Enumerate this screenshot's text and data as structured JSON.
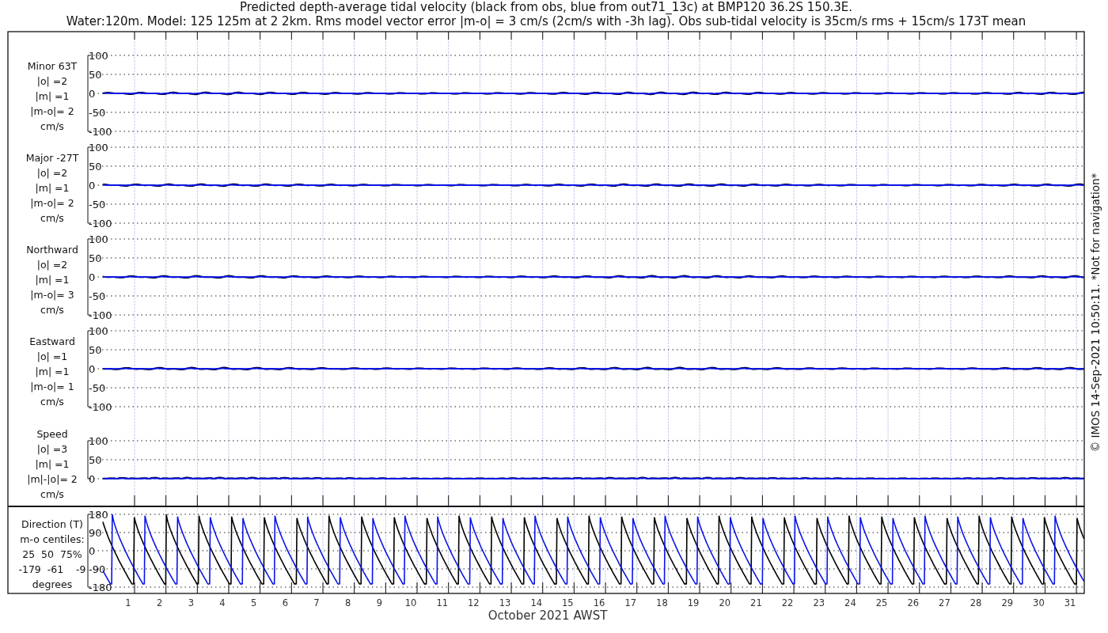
{
  "title_lines": [
    "Predicted depth-average tidal velocity (black from obs, blue from out71_13c) at BMP120 36.2S 150.3E.",
    "Water:120m. Model: 125 125m at 2 2km. Rms model vector error |m-o| = 3 cm/s (2cm/s with -3h lag). Obs sub-tidal velocity is 35cm/s rms + 15cm/s 173T mean"
  ],
  "panels": [
    {
      "kind": "velocity",
      "label_lines": [
        "Minor 63T",
        "|o| =2",
        "|m| =1",
        "|m-o|= 2",
        "cm/s"
      ],
      "y_tick_labels": [
        "100",
        "50",
        "0",
        "-50",
        "-100"
      ]
    },
    {
      "kind": "velocity",
      "label_lines": [
        "Major -27T",
        "|o| =2",
        "|m| =1",
        "|m-o|= 2",
        "cm/s"
      ],
      "y_tick_labels": [
        "100",
        "50",
        "0",
        "-50",
        "-100"
      ]
    },
    {
      "kind": "velocity",
      "label_lines": [
        "Northward",
        "|o| =2",
        "|m| =1",
        "|m-o|= 3",
        "cm/s"
      ],
      "y_tick_labels": [
        "100",
        "50",
        "0",
        "-50",
        "-100"
      ]
    },
    {
      "kind": "velocity",
      "label_lines": [
        "Eastward",
        "|o| =1",
        "|m| =1",
        "|m-o|= 1",
        "cm/s"
      ],
      "y_tick_labels": [
        "100",
        "50",
        "0",
        "-50",
        "-100"
      ]
    },
    {
      "kind": "speed",
      "label_lines": [
        "Speed",
        "|o| =3",
        "|m| =1",
        "|m|-|o|= 2",
        "cm/s"
      ],
      "y_tick_labels": [
        "100",
        "50",
        "0"
      ]
    },
    {
      "kind": "direction",
      "label_lines": [
        "Direction (T)",
        "m-o centiles:",
        "25  50  75%",
        "-179  -61    -9",
        "degrees"
      ],
      "y_tick_labels": [
        "180",
        "90",
        "0",
        "-90",
        "-180"
      ]
    }
  ],
  "x_tick_labels": [
    "1",
    "2",
    "3",
    "4",
    "5",
    "6",
    "7",
    "8",
    "9",
    "10",
    "11",
    "12",
    "13",
    "14",
    "15",
    "16",
    "17",
    "18",
    "19",
    "20",
    "21",
    "22",
    "23",
    "24",
    "25",
    "26",
    "27",
    "28",
    "29",
    "30",
    "31"
  ],
  "xlabel": "October 2021 AWST",
  "side_note": "© IMOS 14-Sep-2021 10:50:11. *Not for navigation*"
}
